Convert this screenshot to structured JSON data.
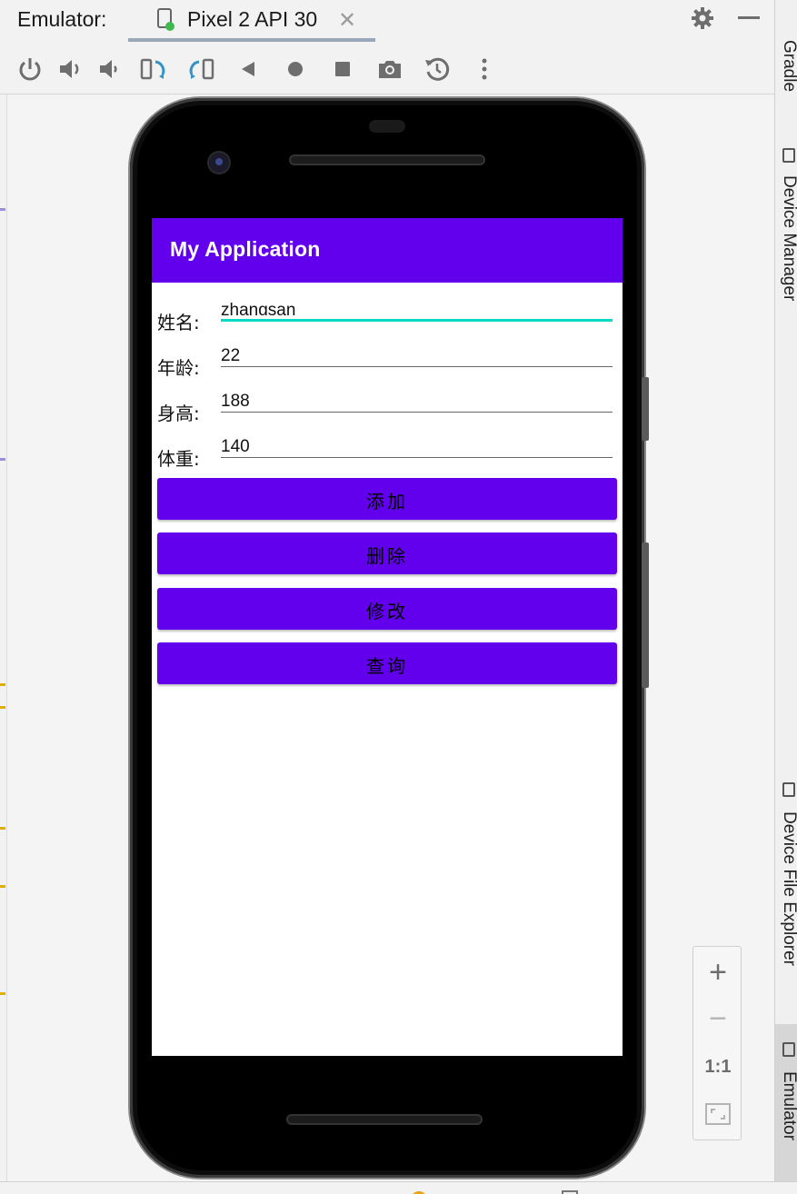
{
  "window": {
    "title": "Emulator:",
    "tab_label": "Pixel 2 API 30",
    "tab_close": "✕"
  },
  "toolbar": {
    "buttons": [
      "power-icon",
      "volume-up-icon",
      "volume-down-icon",
      "rotate-left-icon",
      "rotate-right-icon",
      "back-icon",
      "home-icon",
      "overview-icon",
      "screenshot-icon",
      "snapshot-icon",
      "more-icon"
    ]
  },
  "side_panel": {
    "tabs": [
      "Gradle",
      "Device Manager",
      "Device File Explorer",
      "Emulator"
    ],
    "active": "Emulator"
  },
  "app": {
    "title": "My Application",
    "fields": [
      {
        "label": "姓名:",
        "value": "zhangsan",
        "focused": true
      },
      {
        "label": "年龄:",
        "value": "22",
        "focused": false
      },
      {
        "label": "身高:",
        "value": "188",
        "focused": false
      },
      {
        "label": "体重:",
        "value": "140",
        "focused": false
      }
    ],
    "buttons": [
      "添加",
      "删除",
      "修改",
      "查询"
    ],
    "colors": {
      "primary": "#6200ee",
      "accent": "#03dac5"
    }
  },
  "zoom": {
    "zoom_in": "+",
    "zoom_out": "−",
    "actual_size": "1:1"
  }
}
